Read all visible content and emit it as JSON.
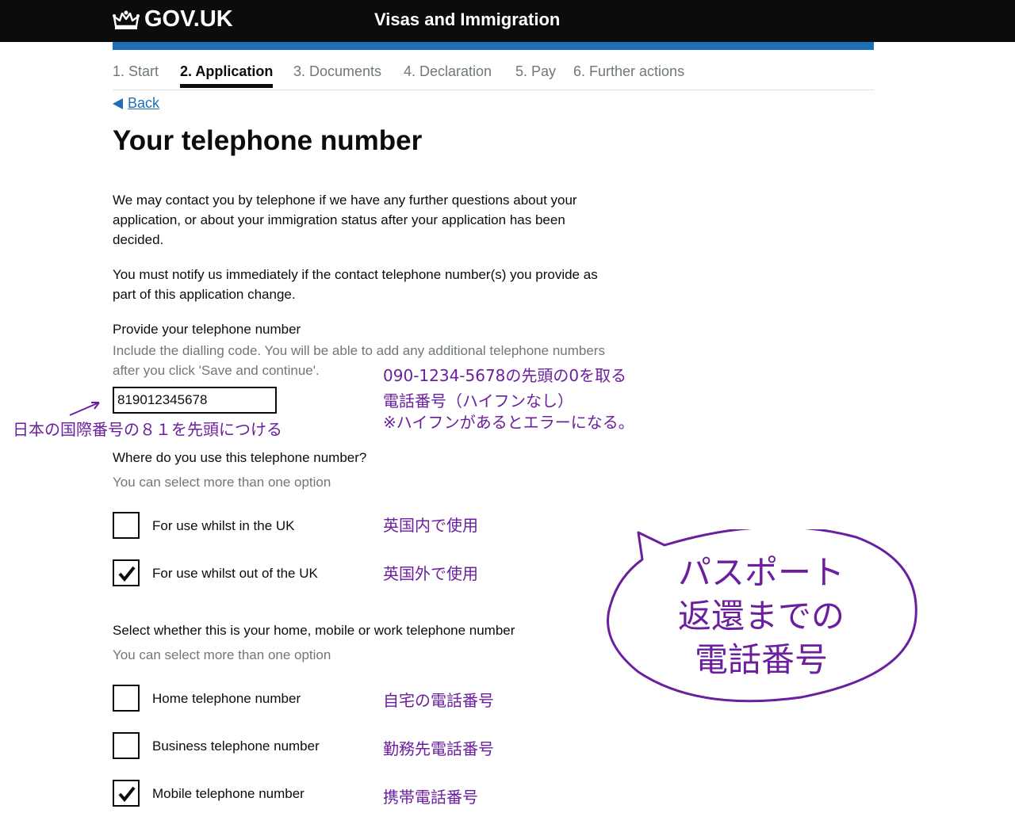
{
  "header": {
    "logo_text": "GOV.UK",
    "service_name": "Visas and Immigration"
  },
  "steps": [
    {
      "label": "1. Start",
      "active": false
    },
    {
      "label": "2. Application",
      "active": true
    },
    {
      "label": "3. Documents",
      "active": false
    },
    {
      "label": "4. Declaration",
      "active": false
    },
    {
      "label": "5. Pay",
      "active": false
    },
    {
      "label": "6. Further actions",
      "active": false
    }
  ],
  "back_label": "Back",
  "page_title": "Your telephone number",
  "intro": {
    "p1_line1": "We may contact you by telephone if we have any further questions about your",
    "p1_line2": "application, or about your immigration status after your application has been",
    "p1_line3": "decided.",
    "p2_line1": "You must notify us immediately if the contact telephone number(s) you provide as",
    "p2_line2": "part of this application change."
  },
  "phone_field": {
    "label": "Provide your telephone number",
    "hint_line1": "Include the dialling code. You will be able to add any additional telephone numbers",
    "hint_line2": "after you click 'Save and continue'.",
    "value": "819012345678"
  },
  "usage_question": {
    "label": "Where do you use this telephone number?",
    "hint": "You can select more than one option",
    "options": [
      {
        "label": "For use whilst in the UK",
        "checked": false,
        "note": "英国内で使用"
      },
      {
        "label": "For use whilst out of the UK",
        "checked": true,
        "note": "英国外で使用"
      }
    ]
  },
  "type_question": {
    "label": "Select whether this is your home, mobile or work telephone number",
    "hint": "You can select more than one option",
    "options": [
      {
        "label": "Home telephone number",
        "checked": false,
        "note": "自宅の電話番号"
      },
      {
        "label": "Business telephone number",
        "checked": false,
        "note": "勤務先電話番号"
      },
      {
        "label": "Mobile telephone number",
        "checked": true,
        "note": "携帯電話番号"
      }
    ]
  },
  "annotations": {
    "number_note_line1": "090-1234-5678の先頭の0を取る",
    "number_note_line2": "電話番号（ハイフンなし）",
    "number_note_line3": "※ハイフンがあるとエラーになる。",
    "country_code_note": "日本の国際番号の８１を先頭につける",
    "bubble_line1": "パスポート",
    "bubble_line2": "返還までの",
    "bubble_line3": "電話番号"
  },
  "colors": {
    "header_bg": "#0b0c0c",
    "brand_blue": "#1d70b8",
    "hint_grey": "#6f777b",
    "annotation_purple": "#6b1f9e"
  }
}
